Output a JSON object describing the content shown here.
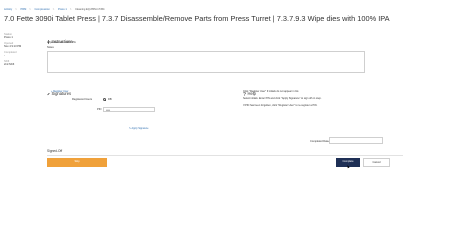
{
  "breadcrumb": {
    "items": [
      "Activity",
      "PRM",
      "Compression",
      "Press 1",
      "Cleaning EQ-PRM-17454"
    ]
  },
  "page": {
    "title": "7.0 Fette 3090i Tablet Press | 7.3.7 Disassemble/Remove Parts from Press Turret | 7.3.7.9.3 Wipe dies with 100% IPA"
  },
  "side_info": [
    {
      "label": "Station",
      "value": "Press 1"
    },
    {
      "label": "Opened",
      "value": "Nov 4 9:13 PM"
    },
    {
      "label": "Completed",
      "value": "-"
    },
    {
      "label": "Shift",
      "value": "2nd Shift"
    }
  ],
  "instructions": {
    "title": "Instructions",
    "text": "Wipe dies with 100% IPA",
    "notes_label": "Notes"
  },
  "signatures": {
    "title": "Signatures",
    "register_link": "Register User",
    "registered_users_label": "Registered Users",
    "registered_user": "DB",
    "pin_label": "PIN",
    "pin_value": "••••",
    "apply_label": "Apply Signature"
  },
  "help": {
    "title": "Help",
    "lines": [
      "Click \"Register User\" if initials do not appear in list.",
      "Select initials. Enter PIN and click \"Apply Signature\" to sign off on step.",
      "If PIN has been forgotten, click \"Register User\" to re-register a PIN."
    ],
    "completed_label": "Completed Date/Time"
  },
  "signed_off": {
    "title": "Signed-Off"
  },
  "buttons": {
    "left_label": "Skip",
    "complete_label": "Complete",
    "cancel_label": "Cancel"
  },
  "colors": {
    "link": "#2f6fb0",
    "accent_orange": "#f0a13a",
    "primary_navy": "#1e2f55"
  }
}
